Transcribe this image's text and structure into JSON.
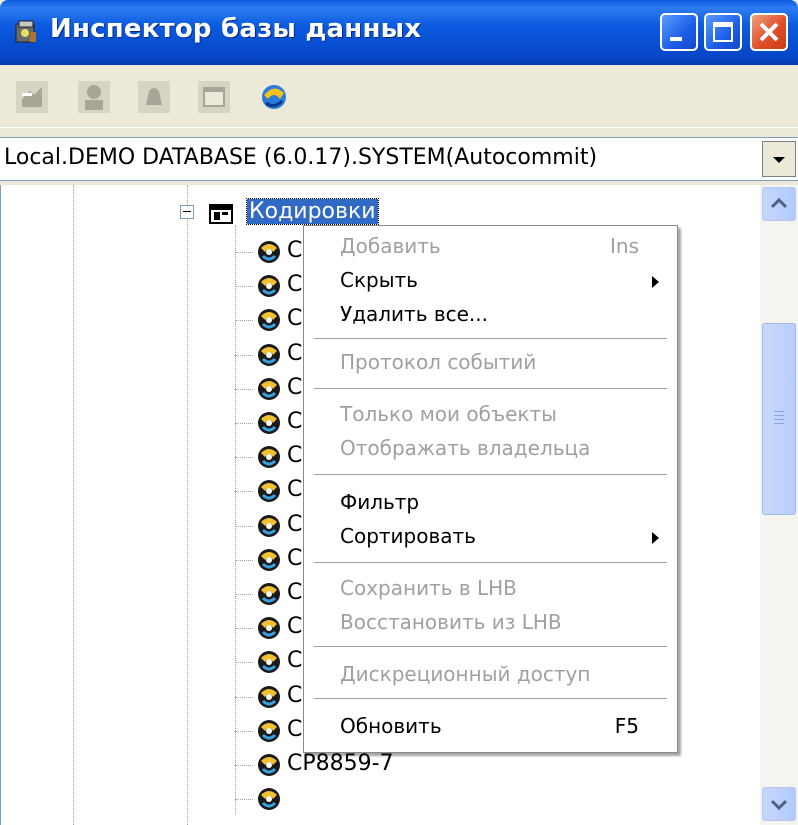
{
  "window": {
    "title": "Инспектор базы данных"
  },
  "connection": {
    "value": "Local.DEMO DATABASE (6.0.17).SYSTEM(Autocommit)"
  },
  "tree": {
    "folder_label": "Кодировки",
    "item_prefix": "C",
    "items_visible_full": [
      "CP8859-6",
      "CP8859-7"
    ]
  },
  "context_menu": {
    "items": [
      {
        "label": "Добавить",
        "shortcut": "Ins",
        "enabled": false
      },
      {
        "label": "Скрыть",
        "submenu": true,
        "enabled": true
      },
      {
        "label": "Удалить все...",
        "enabled": true
      },
      {
        "label": "Протокол событий",
        "enabled": false
      },
      {
        "label": "Только мои объекты",
        "enabled": false
      },
      {
        "label": "Отображать владельца",
        "enabled": false
      },
      {
        "label": "Фильтр",
        "enabled": true
      },
      {
        "label": "Сортировать",
        "submenu": true,
        "enabled": true
      },
      {
        "label": "Сохранить в LHB",
        "enabled": false
      },
      {
        "label": "Восстановить из LHB",
        "enabled": false
      },
      {
        "label": "Дискреционный доступ",
        "enabled": false
      },
      {
        "label": "Обновить",
        "shortcut": "F5",
        "enabled": true
      }
    ]
  },
  "colors": {
    "titlebar": "#0a5ae0",
    "selection": "#316ac5",
    "disabled_text": "#a0a0a0"
  }
}
